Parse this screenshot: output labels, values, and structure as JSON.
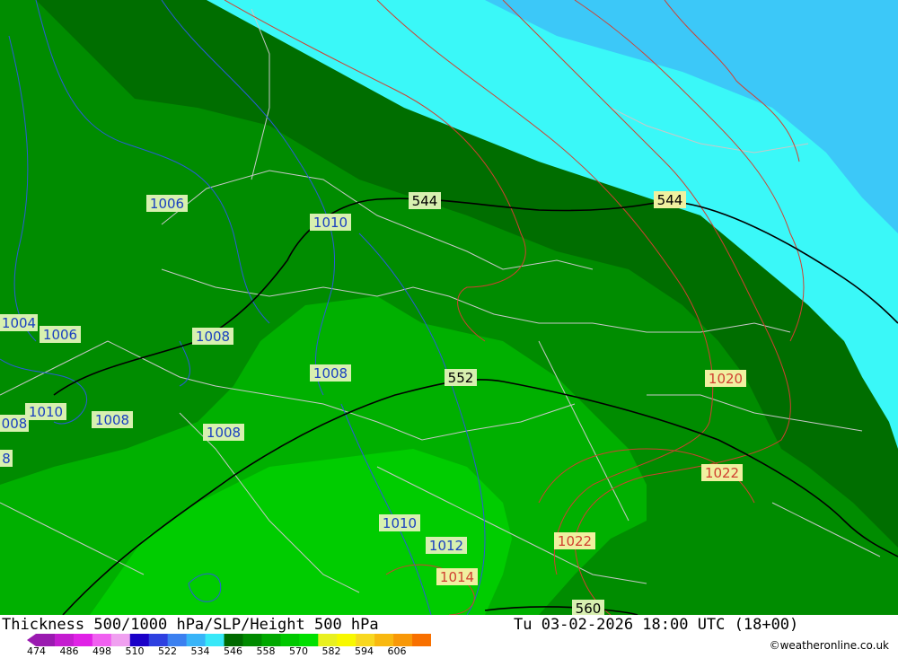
{
  "header": {
    "title": "Thickness 500/1000 hPa/SLP/Height 500 hPa",
    "datetime": "Tu 03-02-2026 18:00 UTC (18+00)"
  },
  "credit": "©weatheronline.co.uk",
  "colors": {
    "scale": [
      "#9a1ab0",
      "#c41cd0",
      "#e021e6",
      "#f060f0",
      "#f0a0f0",
      "#1a00c8",
      "#2e40e0",
      "#3b80f0",
      "#38b4f8",
      "#38e8f8",
      "#006a00",
      "#008a00",
      "#00a800",
      "#00c800",
      "#00e000",
      "#e8f020",
      "#f8f800",
      "#f8d820",
      "#f8b810",
      "#f89808",
      "#f87000"
    ],
    "thickness_dark": "#006e00",
    "thickness_mid": "#008c00",
    "thickness_light": "#00b000",
    "thickness_lighter": "#00cc00",
    "cyan": "#3af8f8",
    "blue": "#3cc8f8"
  },
  "scale_labels": [
    "474",
    "486",
    "498",
    "510",
    "522",
    "534",
    "546",
    "558",
    "570",
    "582",
    "594",
    "606"
  ],
  "height_labels": [
    {
      "id": "h544a",
      "text": "544"
    },
    {
      "id": "h544b",
      "text": "544"
    },
    {
      "id": "h552",
      "text": "552"
    },
    {
      "id": "h560",
      "text": "560"
    }
  ],
  "slp_blue_labels": [
    {
      "id": "b1006a",
      "text": "1006"
    },
    {
      "id": "b1010a",
      "text": "1010"
    },
    {
      "id": "b1004",
      "text": "1004"
    },
    {
      "id": "b1006b",
      "text": "1006"
    },
    {
      "id": "b1008a",
      "text": "1008"
    },
    {
      "id": "b1008b",
      "text": "1008"
    },
    {
      "id": "b008",
      "text": "008"
    },
    {
      "id": "b1010b",
      "text": "1010"
    },
    {
      "id": "b1008c",
      "text": "1008"
    },
    {
      "id": "b1008d",
      "text": "1008"
    },
    {
      "id": "b8",
      "text": "8"
    },
    {
      "id": "b1010c",
      "text": "1010"
    },
    {
      "id": "b1012",
      "text": "1012"
    }
  ],
  "slp_red_labels": [
    {
      "id": "r1020",
      "text": "1020"
    },
    {
      "id": "r1022a",
      "text": "1022"
    },
    {
      "id": "r1022b",
      "text": "1022"
    },
    {
      "id": "r1014",
      "text": "1014"
    }
  ]
}
